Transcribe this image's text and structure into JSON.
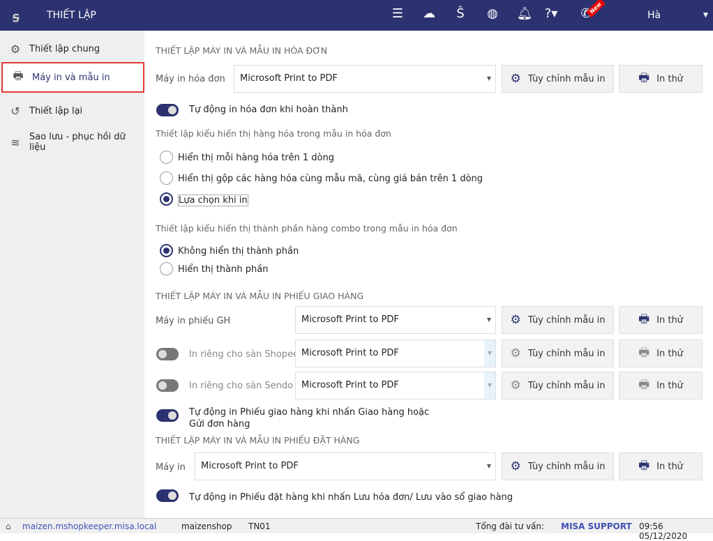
{
  "header": {
    "title": "THIẾT LẬP",
    "user": "Hà",
    "new_badge": "New"
  },
  "sidebar": {
    "items": [
      {
        "label": "Thiết lập chung"
      },
      {
        "label": "Máy in và mẫu in"
      },
      {
        "label": "Thiết lập lại"
      },
      {
        "label": "Sao lưu - phục hồi dữ liệu"
      }
    ]
  },
  "invoice": {
    "section": "THIẾT LẬP MÁY IN VÀ MẪU IN HÓA ĐƠN",
    "printer_label": "Máy in hóa đơn",
    "printer": "Microsoft Print to PDF",
    "customize": "Tùy chỉnh mẫu in",
    "test": "In thử",
    "auto_print": "Tự động in hóa đơn khi hoàn thành",
    "display_title": "Thiết lập kiểu hiển thị hàng hóa trong mẫu in hóa đơn",
    "display_options": [
      "Hiển thị mỗi hàng hóa trên 1 dòng",
      "Hiển thị gộp các hàng hóa cùng mẫu mã, cùng giá bán trên 1 dòng",
      "Lựa chọn khi in"
    ],
    "combo_title": "Thiết lập kiểu hiển thị thành phần hàng combo trong mẫu in hóa đơn",
    "combo_options": [
      "Không hiển thị thành phần",
      "Hiển thị thành phần"
    ]
  },
  "delivery": {
    "section": "THIẾT LẬP MÁY IN VÀ MẪU IN PHIẾU GIAO HÀNG",
    "printer_label": "Máy in phiếu GH",
    "printer": "Microsoft Print to PDF",
    "shopee_label": "In riêng cho sàn Shopee",
    "shopee_printer": "Microsoft Print to PDF",
    "sendo_label": "In riêng cho sàn Sendo",
    "sendo_printer": "Microsoft Print to PDF",
    "customize": "Tùy chỉnh mẫu in",
    "test": "In thử",
    "auto_print_1": "Tự động in Phiếu giao hàng khi nhấn Giao hàng hoặc",
    "auto_print_2": "Gửi đơn hàng"
  },
  "order": {
    "section": "THIẾT LẬP MÁY IN VÀ MẪU IN PHIẾU ĐẶT HÀNG",
    "printer_label": "Máy in",
    "printer": "Microsoft Print to PDF",
    "customize": "Tùy chỉnh mẫu in",
    "test": "In thử",
    "auto_print": "Tự động in Phiếu đặt hàng khi nhấn Lưu hóa đơn/ Lưu vào sổ giao hàng"
  },
  "status": {
    "url": "maizen.mshopkeeper.misa.local",
    "shop": "maizenshop",
    "branch": "TN01",
    "support_label": "Tổng đài tư vấn:",
    "support": "MISA SUPPORT",
    "datetime": "09:56 05/12/2020"
  }
}
